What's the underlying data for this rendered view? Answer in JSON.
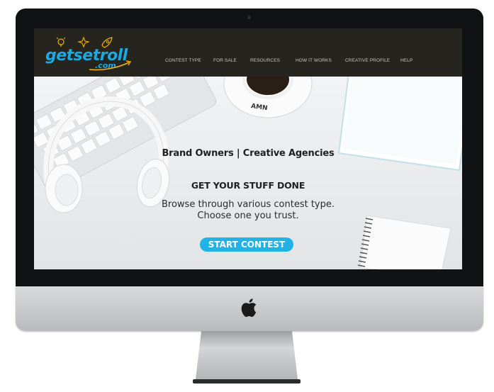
{
  "brand": {
    "logo_main": "getsetroll",
    "logo_suffix": ".com",
    "color": "#1ba9e1"
  },
  "nav": {
    "items": [
      {
        "label": "CONTEST TYPE"
      },
      {
        "label": "FOR SALE"
      },
      {
        "label": "RESOURCES"
      },
      {
        "label": "HOW IT WORKS"
      },
      {
        "label": "CREATIVE PROFILE"
      },
      {
        "label": "HELP"
      }
    ]
  },
  "hero": {
    "subtitle": "Brand Owners | Creative Agencies",
    "title": "GET YOUR STUFF DONE",
    "body_line1": "Browse through various contest type.",
    "body_line2": "Choose one you trust.",
    "cta_label": "START CONTEST",
    "cta_color": "#22b3e6"
  },
  "device": {
    "icons": [
      "apple-icon"
    ]
  }
}
